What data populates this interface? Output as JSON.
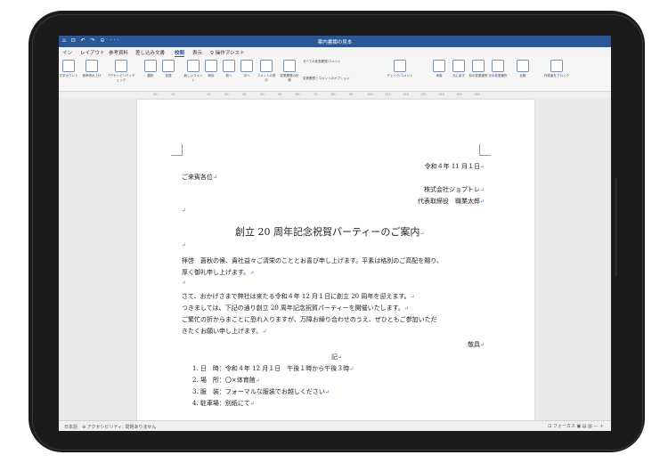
{
  "titlebar": {
    "quick_access": "⌂ ⊡ ↶ ↷ ⊝ ···",
    "doc_title": "案内書類の見本"
  },
  "tabs": [
    "イン",
    "レイアウト",
    "参考資料",
    "差し込み文書",
    "校閲",
    "表示",
    "♀ 操作アシスト"
  ],
  "ribbon": [
    {
      "label": "文字カウント"
    },
    {
      "label": "音声読み上げ"
    },
    {
      "label": "アクセシビリティチェック"
    },
    {
      "label": "翻訳"
    },
    {
      "label": "言語"
    },
    {
      "label": "新しいコメント"
    },
    {
      "label": "削除"
    },
    {
      "label": "前へ"
    },
    {
      "label": "次へ"
    },
    {
      "label": "コメントの表示"
    },
    {
      "label": "変更履歴の記録"
    },
    {
      "label": "すべての変更履歴/コメント"
    },
    {
      "label": "変更履歴とコメントのオプション"
    },
    {
      "label": "チェック/コメント"
    },
    {
      "label": "承諾"
    },
    {
      "label": "元に戻す"
    },
    {
      "label": "前の変更箇所"
    },
    {
      "label": "次の変更箇所"
    },
    {
      "label": "比較"
    },
    {
      "label": "作成者をブロック"
    }
  ],
  "ruler": [
    "20",
    "10",
    "",
    "10",
    "20",
    "30",
    "40",
    "50",
    "60",
    "70",
    "80",
    "90",
    "100",
    "110",
    "120",
    "130",
    "140",
    "150",
    "160"
  ],
  "document": {
    "date": "令和４年 11 月１日",
    "to": "ご来賓各位",
    "company": "株式会社ジョブトレ",
    "representative": "代表取締役　職業太郎",
    "heading": "創立 20 周年記念祝賀パーティーのご案内",
    "p1_l1": "拝啓　蒼秋の候、貴社益々ご清栄のこととお喜び申し上げます。平素は格別のご高配を賜り、",
    "p1_l2": "厚く御礼申し上げます。",
    "p2_l1": "さて、おかげさまで弊社は来たる令和４年 12 月１日に創立 20 周年を迎えます。",
    "p2_l2": "つきましては、下記の通り創立 20 周年記念祝賀パーティーを開催いたします。",
    "p2_l3": "ご繁忙の折からまことに恐れ入りますが、万障お繰り合わせのうえ、ぜひともご参加いただ",
    "p2_l4": "きたくお願い申し上げます。",
    "closing": "敬具",
    "ki": "記",
    "items": [
      "1. 日　時：令和４年 12 月１日　午後１時から午後３時",
      "2. 場　所：〇×体育館",
      "3. 服　装：フォーマルな服装でお越しください",
      "4. 駐車場：別紙にて"
    ],
    "para_mark": "↵"
  },
  "status": {
    "left": "日本語　⊕ アクセシビリティ: 問題ありません",
    "right": "⊡ フォーカス ▣ ▤ ▥ — ＋"
  }
}
